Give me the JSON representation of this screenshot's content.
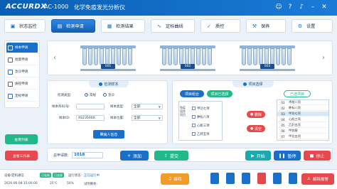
{
  "header": {
    "brand": "ACCURDX",
    "model": "AC-1000",
    "title": "化学免疫发光分析仪"
  },
  "nav": [
    {
      "label": "状态监控",
      "icon": "monitor-icon"
    },
    {
      "label": "检测申请",
      "icon": "apply-icon",
      "active": true
    },
    {
      "label": "检测结果",
      "icon": "result-icon"
    },
    {
      "label": "定标曲线",
      "icon": "curve-icon"
    },
    {
      "label": "质控",
      "icon": "qc-icon"
    },
    {
      "label": "保养",
      "icon": "maintain-icon"
    },
    {
      "label": "设置",
      "icon": "settings-icon"
    }
  ],
  "sidebar": {
    "items": [
      {
        "label": "样本申请",
        "active": true
      },
      {
        "label": "批量申请"
      },
      {
        "label": "急诊申请"
      },
      {
        "label": "质控申请"
      },
      {
        "label": "定标申请"
      }
    ],
    "buttons": [
      {
        "label": "查看列表"
      },
      {
        "label": "查看工作表"
      }
    ]
  },
  "rack": {
    "positions": [
      "001",
      "002",
      "003"
    ]
  },
  "sample_info": {
    "title": "检测样本",
    "fields": {
      "test_type_label": "检测类型:",
      "test_type_options": [
        "常规",
        "急诊"
      ],
      "sample_barcode_label": "样本条码/号:",
      "sample_barcode_value": "",
      "sample_id_label": "样本ID:",
      "sample_id_value": "AS235000",
      "sample_type_label": "样本类型:",
      "sample_type_value": "全部",
      "sample_pos_label": "样本位置:",
      "sample_pos_value": "全部"
    },
    "patient_btn": "病人信息"
  },
  "item_select": {
    "title": "项目选择",
    "combo_btn": "项目组合",
    "selected_btn": "项目已选择",
    "selected_label": "已选项目",
    "groups": [
      "甲功七项",
      "肿标八项",
      "心肌三项",
      "乙肝五项"
    ],
    "left_header": "免疫组合项目",
    "delete_btn": "删除",
    "clear_btn": "清空",
    "selected_rows": [
      {
        "no": "01",
        "name": "术前八项"
      },
      {
        "no": "02",
        "name": "肿标八项"
      },
      {
        "no": "03",
        "name": "甲功七项"
      },
      {
        "no": "04",
        "name": "心肌三项"
      },
      {
        "no": "05",
        "name": "乙肝五项"
      },
      {
        "no": "06",
        "name": "甲状腺"
      },
      {
        "no": "07",
        "name": "甲功五项"
      }
    ]
  },
  "actions": {
    "total_label": "总申请数:",
    "total_value": "1018",
    "add_label": "添加",
    "submit_label": "提交",
    "start_label": "开始",
    "pause_label": "暂停",
    "stop_label": "停止"
  },
  "status": {
    "device_label": "设备/定机通信",
    "device_state": "已连接",
    "lis_state": "已连接",
    "run_label": "运行状态:",
    "run_value": "正在运行中",
    "datetime": "2026-06-08 15:00:00",
    "temp": "25℃",
    "humidity": "50%",
    "remaining": "试剂剩余:",
    "buzzer": "蜂鸣",
    "pause": "暂停",
    "alarm": "解除报警"
  },
  "colors": {
    "primary": "#1a6fc9",
    "green": "#21b98a",
    "orange": "#f29b2b",
    "red": "#e5484d",
    "teal": "#1aa9b0"
  }
}
